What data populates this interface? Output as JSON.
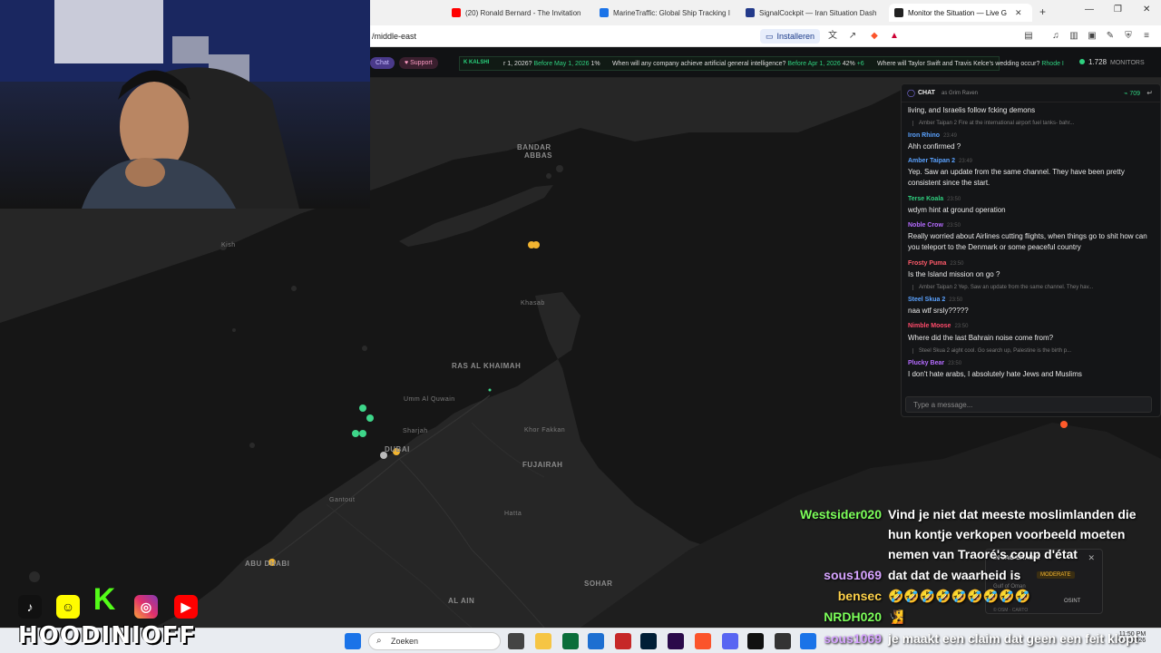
{
  "browser": {
    "tabs": [
      {
        "title": "(20) Ronald Bernard - The Invitation",
        "color": "#ff0000"
      },
      {
        "title": "MarineTraffic: Global Ship Tracking I",
        "color": "#1a73e8"
      },
      {
        "title": "SignalCockpit — Iran Situation Dash",
        "color": "#233a8a"
      },
      {
        "title": "Monitor the Situation — Live G",
        "color": "#222222"
      }
    ],
    "url": "/middle-east",
    "install_label": "Installeren"
  },
  "ticker": {
    "chat_label": "Chat",
    "support_label": "Support",
    "kalshi_label": "KALSHI",
    "q1_prefix": "r 1, 2026?",
    "q1_date": "Before May 1, 2026",
    "q1_pct": "1%",
    "q2": "When will any company achieve artificial general intelligence?",
    "q2_date": "Before Apr 1, 2026",
    "q2_pct": "42%",
    "q2_delta": "+6",
    "q3": "Where will Taylor Swift and Travis Kelce's wedding occur?",
    "q3_date": "Rhode I",
    "monitors_count": "1.728",
    "monitors_label": "MONITORS"
  },
  "map": {
    "labels": {
      "bandar_abbas_1": "BANDAR",
      "bandar_abbas_2": "ABBAS",
      "kish": "Kish",
      "khasab": "Khasab",
      "ras_al_khaimah": "RAS AL KHAIMAH",
      "umm_al_quwain": "Umm Al Quwain",
      "sharjah": "Sharjah",
      "khor_fakkan": "Khor Fakkan",
      "dubai": "DUBAI",
      "fujairah": "FUJAIRAH",
      "jebel_ali": "Gantout",
      "hatta": "Hatta",
      "abu_dhabi": "ABU DHABI",
      "al_ain": "AL AIN",
      "sohar": "SOHAR"
    },
    "marker_colors": {
      "yellow": "#f2b430",
      "green": "#3ed68a",
      "red": "#ff5a2a"
    }
  },
  "chat": {
    "title": "CHAT",
    "as_user": "as Grim Raven",
    "count": "709",
    "input_placeholder": "Type a message...",
    "messages": [
      {
        "user": "",
        "time": "",
        "text": "living, and Israelis follow fcking demons",
        "color": "#ffffff"
      },
      {
        "reply": "Amber Taipan 2 Fire at the international airport fuel tanks- bahr..."
      },
      {
        "user": "Iron Rhino",
        "time": "23:49",
        "text": "Ahh confirmed ?",
        "color": "#5aa2ff"
      },
      {
        "user": "Amber Taipan 2",
        "time": "23:49",
        "text": "Yep. Saw an update from the same channel. They have been pretty consistent since the start.",
        "color": "#5aa2ff"
      },
      {
        "user": "Terse Koala",
        "time": "23:50",
        "text": "wdym hint at ground operation",
        "color": "#2fd07f"
      },
      {
        "user": "Noble Crow",
        "time": "23:50",
        "text": "Really worried about Airlines cutting flights, when things go to shit how can you teleport to the Denmark or some peaceful country",
        "color": "#b56bff"
      },
      {
        "user": "Frosty Puma",
        "time": "23:50",
        "text": "Is the Island mission on go ?",
        "color": "#ff5a6a"
      },
      {
        "reply": "Amber Taipan 2 Yep. Saw an update from the same channel. They hav..."
      },
      {
        "user": "Steel Skua 2",
        "time": "23:50",
        "text": "naa wtf srsly?????",
        "color": "#5aa2ff"
      },
      {
        "user": "Nimble Moose",
        "time": "23:50",
        "text": "Where did the last Bahrain noise come from?",
        "color": "#ff4a6a"
      },
      {
        "reply": "Steel Skua 2 aight cool. Go search up, Palestine is the birth p..."
      },
      {
        "user": "Plucky Bear",
        "time": "23:50",
        "text": "I don't hate arabs, I absolutely hate Jews and Muslims",
        "color": "#b56bff"
      }
    ]
  },
  "overlay_chat": [
    {
      "user": "Westsider020",
      "color": "#7cff5a",
      "lines": [
        "Vind je niet dat meeste moslimlanden die",
        "hun kontje verkopen voorbeeld moeten",
        "nemen van Traoré's coup d'état"
      ]
    },
    {
      "user": "sous1069",
      "color": "#d6a3ff",
      "lines": [
        "dat dat de waarheid is"
      ]
    },
    {
      "user": "bensec",
      "color": "#ffd24a",
      "lines": [
        "🤣🤣🤣🤣🤣🤣🤣🤣🤣"
      ]
    },
    {
      "user": "NRDH020",
      "color": "#7cff5a",
      "lines": [
        "🧏"
      ]
    },
    {
      "user": "sous1069",
      "color": "#d6a3ff",
      "lines": [
        "je maakt een claim dat geen een feit klopt"
      ]
    }
  ],
  "popup": {
    "title": "IN JAG LRADKI",
    "tag1": "MODERATE",
    "region": "Gulf of Oman",
    "tag2": "OSINT",
    "footer": "© OSM · CARTO"
  },
  "branding": {
    "name": "HOODINIOFF"
  },
  "taskbar": {
    "search_placeholder": "Zoeken",
    "time": "11:50 PM",
    "date": "3/23/2026"
  }
}
